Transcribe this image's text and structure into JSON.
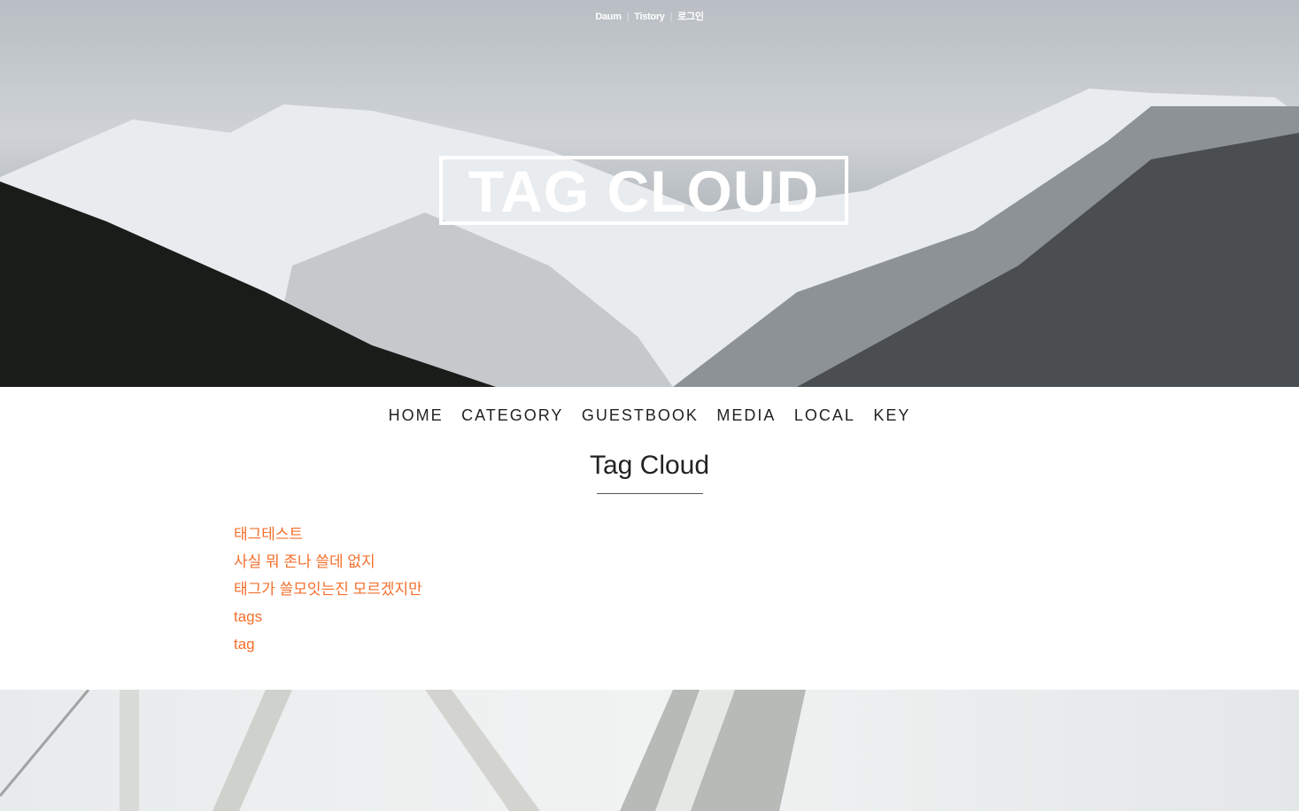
{
  "top_links": [
    "Daum",
    "Tistory",
    "로그인"
  ],
  "blog_title": "TAG CLOUD",
  "menu": [
    "HOME",
    "CATEGORY",
    "GUESTBOOK",
    "MEDIA",
    "LOCAL",
    "KEY"
  ],
  "page_title": "Tag Cloud",
  "tags": [
    "태그테스트",
    "사실 뭐 존나 쓸데 없지",
    "태그가 쓸모잇는진 모르겠지만",
    "tags",
    "tag"
  ],
  "colors": {
    "tag": "#f36f2c"
  }
}
